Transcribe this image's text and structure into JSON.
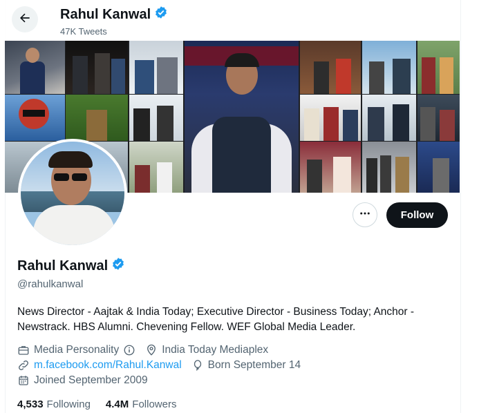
{
  "header": {
    "name": "Rahul Kanwal",
    "tweet_count": "47K Tweets"
  },
  "profile": {
    "name": "Rahul Kanwal",
    "handle": "@rahulkanwal",
    "bio": "News Director - Aajtak & India Today; Executive Director - Business Today; Anchor - Newstrack. HBS Alumni. Chevening Fellow. WEF Global Media Leader.",
    "category": "Media Personality",
    "location": "India Today Mediaplex",
    "website": "m.facebook.com/Rahul.Kanwal",
    "birthday": "Born September 14",
    "joined": "Joined September 2009"
  },
  "actions": {
    "follow_label": "Follow"
  },
  "stats": {
    "following_count": "4,533",
    "following_label": "Following",
    "followers_count": "4.4M",
    "followers_label": "Followers"
  },
  "colors": {
    "accent": "#1d9bf0",
    "text": "#0f1419",
    "secondary": "#536471",
    "verified": "#1d9bf0"
  },
  "icons": {
    "back": "arrow-left-icon",
    "verified": "verified-badge-icon",
    "more": "more-horizontal-icon",
    "category": "briefcase-icon",
    "info": "info-icon",
    "location": "location-pin-icon",
    "link": "link-icon",
    "birthday": "balloon-icon",
    "joined": "calendar-icon"
  }
}
